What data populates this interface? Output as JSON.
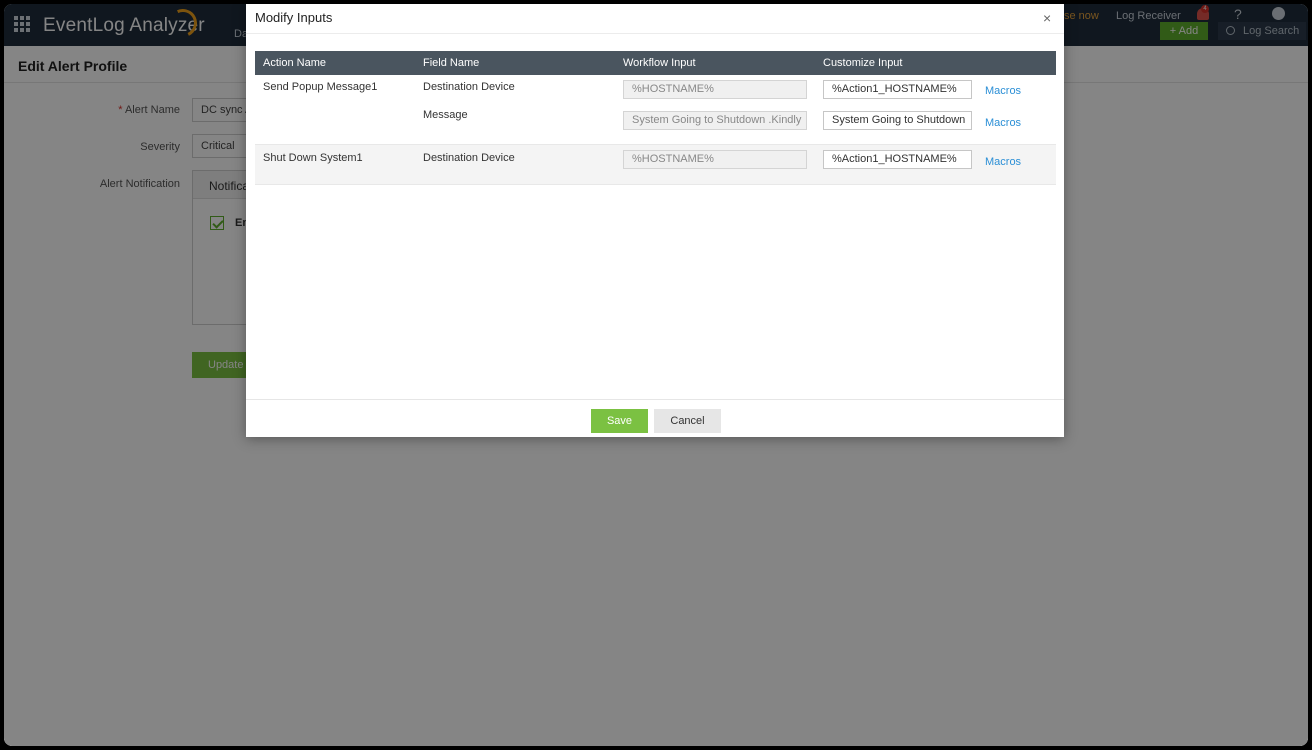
{
  "app": {
    "brand": "EventLog Analyzer",
    "nav_partial": "Da",
    "license_link": "se now",
    "log_receiver": "Log Receiver",
    "notification_count": "4",
    "help_glyph": "?",
    "add_label": "+ Add",
    "log_search_label": "Log Search"
  },
  "page": {
    "title": "Edit Alert Profile",
    "alert_name_label": "Alert Name",
    "alert_name_value": "DC sync A",
    "severity_label": "Severity",
    "severity_value": "Critical",
    "alert_notification_label": "Alert Notification",
    "notification_tab": "Notifica",
    "notification_option": "En",
    "update_label": "Update"
  },
  "modal": {
    "title": "Modify Inputs",
    "close_glyph": "×",
    "columns": [
      "Action Name",
      "Field Name",
      "Workflow Input",
      "Customize Input"
    ],
    "rows": [
      {
        "action": "Send Popup Message1",
        "fields": [
          {
            "field": "Destination Device",
            "workflow": "%HOSTNAME%",
            "custom": "%Action1_HOSTNAME%",
            "macros": "Macros"
          },
          {
            "field": "Message",
            "workflow": "System Going to Shutdown .Kindly",
            "custom": "System Going to Shutdown",
            "macros": "Macros"
          }
        ]
      },
      {
        "action": "Shut Down System1",
        "fields": [
          {
            "field": "Destination Device",
            "workflow": "%HOSTNAME%",
            "custom": "%Action1_HOSTNAME%",
            "macros": "Macros"
          }
        ]
      }
    ],
    "save_label": "Save",
    "cancel_label": "Cancel"
  },
  "colors": {
    "topbar": "#1f2d3d",
    "accent_green": "#7bc142",
    "table_header": "#4a555f",
    "link_blue": "#2b8fd6"
  }
}
